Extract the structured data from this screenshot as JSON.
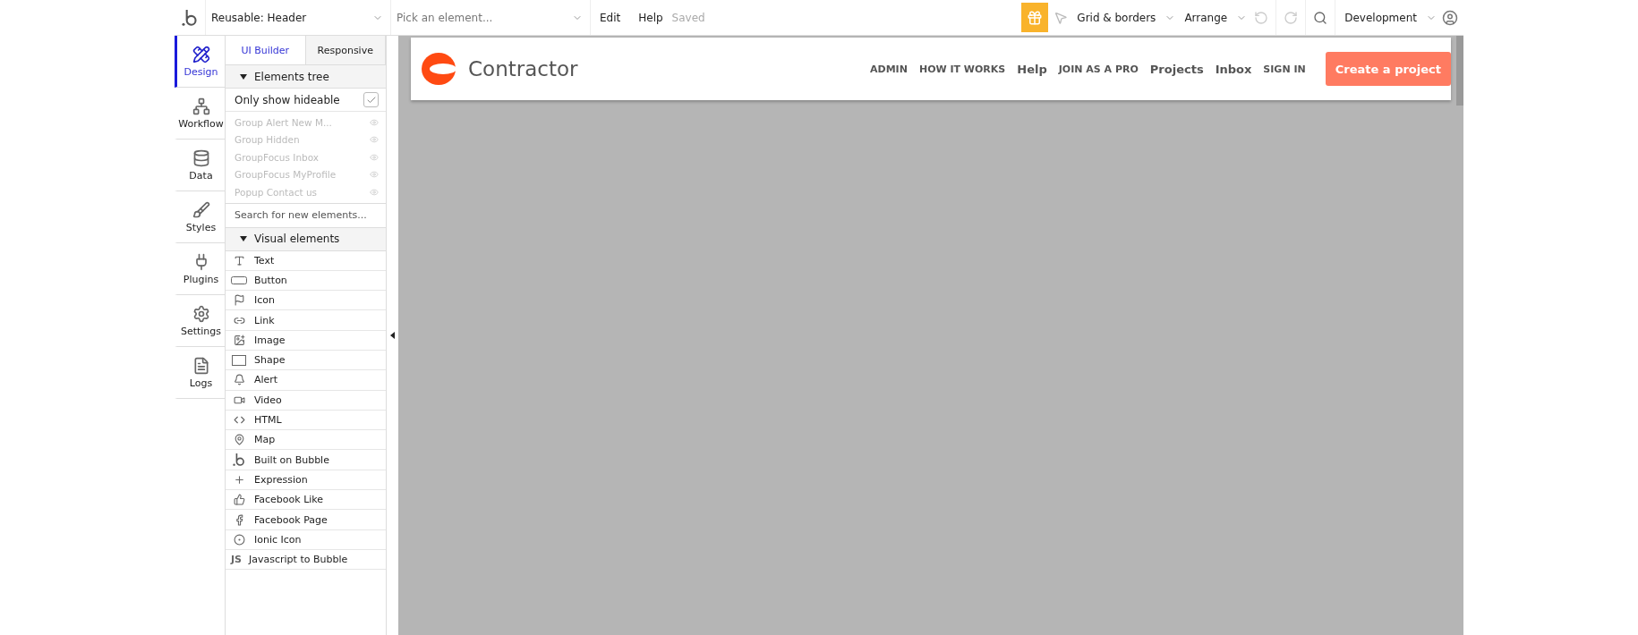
{
  "toolbar": {
    "page_select": "Reusable: Header",
    "element_picker": {
      "placeholder": "Pick an element..."
    },
    "menu": [
      "Edit",
      "Help"
    ],
    "status": "Saved",
    "grid": "Grid & borders",
    "arrange": "Arrange",
    "environment": "Development"
  },
  "sidebar": {
    "items": [
      {
        "label": "Design",
        "kind": "design",
        "selected": true
      },
      {
        "label": "Workflow",
        "kind": "workflow",
        "selected": false
      },
      {
        "label": "Data",
        "kind": "data",
        "selected": false
      },
      {
        "label": "Styles",
        "kind": "styles",
        "selected": false
      },
      {
        "label": "Plugins",
        "kind": "plugins",
        "selected": false
      },
      {
        "label": "Settings",
        "kind": "settings",
        "selected": false
      },
      {
        "label": "Logs",
        "kind": "logs",
        "selected": false
      }
    ]
  },
  "panel": {
    "tabs": [
      {
        "label": "UI Builder",
        "selected": true
      },
      {
        "label": "Responsive",
        "selected": false
      }
    ],
    "tree_section": {
      "title": "Elements tree",
      "expanded": true
    },
    "only_hideable": {
      "label": "Only show hideable",
      "checked": true
    },
    "tree_items": [
      "Group Alert New M...",
      "Group Hidden",
      "GroupFocus Inbox",
      "GroupFocus MyProfile",
      "Popup Contact us"
    ],
    "search": {
      "placeholder": "Search for new elements..."
    },
    "visual_section": {
      "title": "Visual elements",
      "expanded": true
    },
    "elements": [
      {
        "label": "Text",
        "kind": "text"
      },
      {
        "label": "Button",
        "kind": "button"
      },
      {
        "label": "Icon",
        "kind": "icon"
      },
      {
        "label": "Link",
        "kind": "link"
      },
      {
        "label": "Image",
        "kind": "image"
      },
      {
        "label": "Shape",
        "kind": "shape"
      },
      {
        "label": "Alert",
        "kind": "alert"
      },
      {
        "label": "Video",
        "kind": "video"
      },
      {
        "label": "HTML",
        "kind": "html"
      },
      {
        "label": "Map",
        "kind": "map"
      },
      {
        "label": "Built on Bubble",
        "kind": "bubble"
      },
      {
        "label": "Expression",
        "kind": "expression"
      },
      {
        "label": "Facebook Like",
        "kind": "like"
      },
      {
        "label": "Facebook Page",
        "kind": "facebook"
      },
      {
        "label": "Ionic Icon",
        "kind": "ionic"
      },
      {
        "label": "Javascript to Bubble",
        "kind": "js",
        "glyph": "JS"
      }
    ]
  },
  "preview": {
    "brand": "Contractor",
    "nav": [
      {
        "label": "ADMIN",
        "kind": "caps"
      },
      {
        "label": "HOW IT WORKS",
        "kind": "caps"
      },
      {
        "label": "Help",
        "kind": "title"
      },
      {
        "label": "JOIN AS A PRO",
        "kind": "caps"
      },
      {
        "label": "Projects",
        "kind": "title"
      },
      {
        "label": "Inbox",
        "kind": "title"
      },
      {
        "label": "SIGN IN",
        "kind": "caps"
      }
    ],
    "cta": "Create a project"
  }
}
